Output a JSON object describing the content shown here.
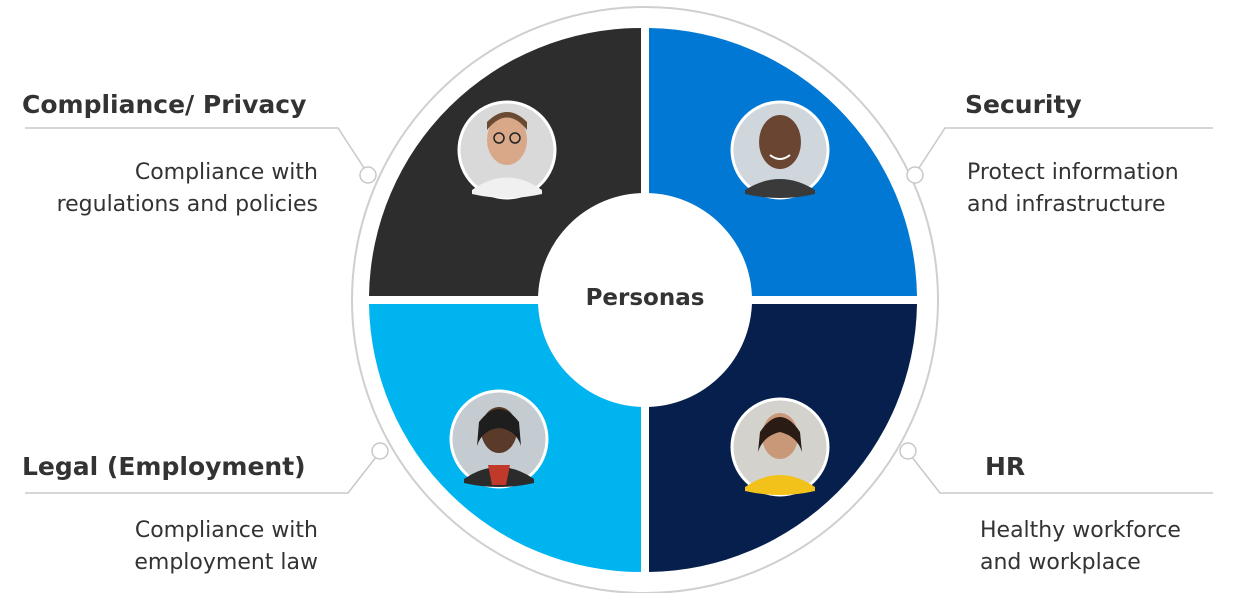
{
  "center": {
    "label": "Personas"
  },
  "personas": [
    {
      "key": "compliance",
      "title": "Compliance/ Privacy",
      "desc_line1": "Compliance with",
      "desc_line2": "regulations and policies",
      "color": "#2d2d2d",
      "avatar": "person-glasses-avatar"
    },
    {
      "key": "security",
      "title": "Security",
      "desc_line1": "Protect information",
      "desc_line2": "and infrastructure",
      "color": "#0078d4",
      "avatar": "person-smiling-avatar"
    },
    {
      "key": "legal",
      "title": "Legal (Employment)",
      "desc_line1": "Compliance with",
      "desc_line2": "employment law",
      "color": "#00b4ef",
      "avatar": "person-woman-avatar"
    },
    {
      "key": "hr",
      "title": "HR",
      "desc_line1": "Healthy workforce",
      "desc_line2": "and workplace",
      "color": "#061f4c",
      "avatar": "person-yellow-jacket-avatar"
    }
  ],
  "colors": {
    "connector": "#c8c8c8",
    "outer_ring": "#cfcfcf",
    "text": "#333333"
  }
}
